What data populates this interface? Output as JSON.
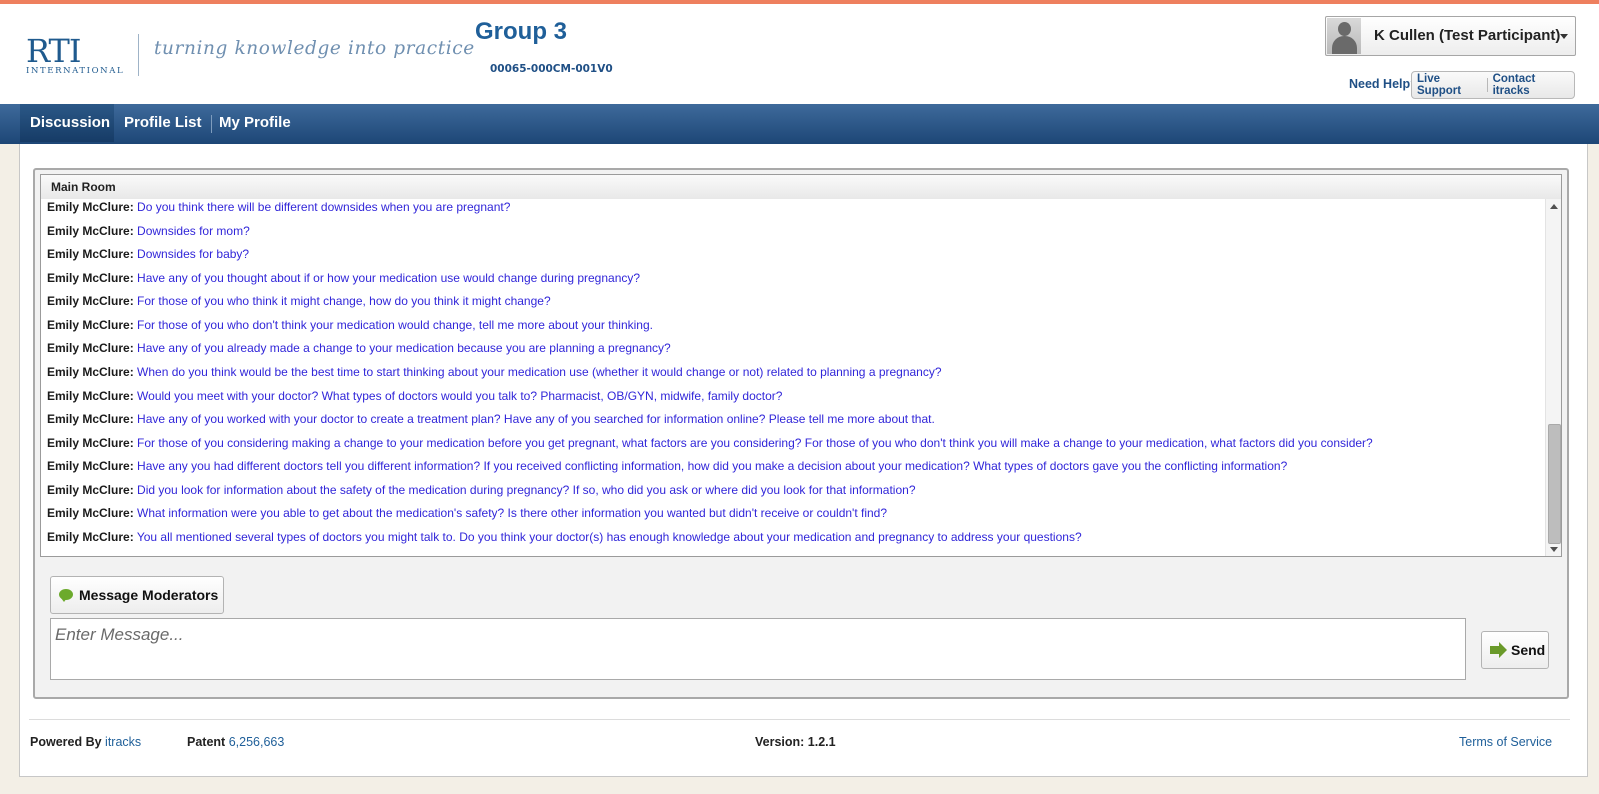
{
  "brand": {
    "logo_text": "RTI",
    "logo_subtext": "INTERNATIONAL",
    "tagline": "turning knowledge into practice",
    "accent_color": "#ee7f5e",
    "nav_color": "#1d4676",
    "message_color": "#3126d9"
  },
  "header": {
    "group_title": "Group 3",
    "project_code": "00065-000CM-001V0",
    "user_name": "K Cullen (Test Participant)",
    "need_help": "Need Help?",
    "live_support": "Live Support",
    "contact": "Contact itracks"
  },
  "nav": {
    "items": [
      {
        "label": "Discussion",
        "active": true
      },
      {
        "label": "Profile List",
        "active": false
      },
      {
        "label": "My Profile",
        "active": false
      }
    ]
  },
  "chat": {
    "room_title": "Main Room",
    "messages": [
      {
        "author": "Emily McClure:",
        "text": "Do you think there will be different downsides when you are pregnant?"
      },
      {
        "author": "Emily McClure:",
        "text": "Downsides for mom?"
      },
      {
        "author": "Emily McClure:",
        "text": "Downsides for baby?"
      },
      {
        "author": "Emily McClure:",
        "text": "Have any of you thought about if or how your medication use would change during pregnancy?"
      },
      {
        "author": "Emily McClure:",
        "text": "For those of you who think it might change, how do you think it might change?"
      },
      {
        "author": "Emily McClure:",
        "text": "For those of you who don't think your medication would change, tell me more about your thinking."
      },
      {
        "author": "Emily McClure:",
        "text": "Have any of you already made a change to your medication because you are planning a pregnancy?"
      },
      {
        "author": "Emily McClure:",
        "text": "When do you think would be the best time to start thinking about your medication use (whether it would change or not) related to planning a pregnancy?"
      },
      {
        "author": "Emily McClure:",
        "text": "Would you meet with your doctor? What types of doctors would you talk to? Pharmacist, OB/GYN, midwife, family doctor?"
      },
      {
        "author": "Emily McClure:",
        "text": "Have any of you worked with your doctor to create a treatment plan? Have any of you searched for information online? Please tell me more about that."
      },
      {
        "author": "Emily McClure:",
        "text": "For those of you considering making a change to your medication before you get pregnant, what factors are you considering? For those of you who don't think you will make a change to your medication, what factors did you consider?"
      },
      {
        "author": "Emily McClure:",
        "text": "Have any you had different doctors tell you different information? If you received conflicting information, how did you make a decision about your medication? What types of doctors gave you the conflicting information?"
      },
      {
        "author": "Emily McClure:",
        "text": "Did you look for information about the safety of the medication during pregnancy? If so, who did you ask or where did you look for that information?"
      },
      {
        "author": "Emily McClure:",
        "text": "What information were you able to get about the medication's safety? Is there other information you wanted but didn't receive or couldn't find?"
      },
      {
        "author": "Emily McClure:",
        "text": "You all mentioned several types of doctors you might talk to. Do you think your doctor(s) has enough knowledge about your medication and pregnancy to address your questions?"
      }
    ],
    "message_moderators_label": "Message Moderators",
    "input_placeholder": "Enter Message...",
    "input_value": "",
    "send_label": "Send"
  },
  "footer": {
    "powered_by_label": "Powered By",
    "powered_by_link": "itracks",
    "patent_label": "Patent",
    "patent_number": "6,256,663",
    "version": "Version: 1.2.1",
    "terms": "Terms of Service"
  }
}
